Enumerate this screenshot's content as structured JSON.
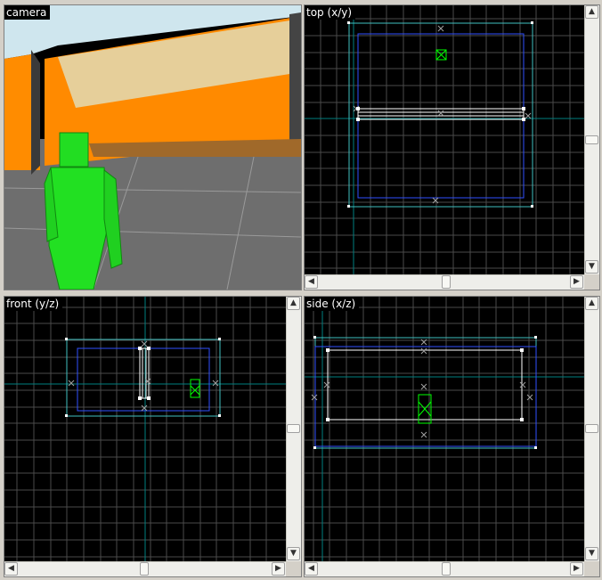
{
  "viewports": {
    "camera": {
      "label": "camera"
    },
    "top": {
      "label": "top (x/y)"
    },
    "front": {
      "label": "front (y/z)"
    },
    "side": {
      "label": "side (x/z)"
    }
  },
  "scrollbar_icons": {
    "up": "▲",
    "down": "▼",
    "left": "◀",
    "right": "▶"
  },
  "colors": {
    "background": "#d4d0c8",
    "viewport_bg": "#000000",
    "grid": "#5a5a5a",
    "axis": "#008080",
    "brush_blue": "#3050ff",
    "brush_cyan": "#40c0c0",
    "entity_green": "#00ff00",
    "wall_orange": "#ff8800",
    "floor_gray": "#6e6e6e"
  }
}
